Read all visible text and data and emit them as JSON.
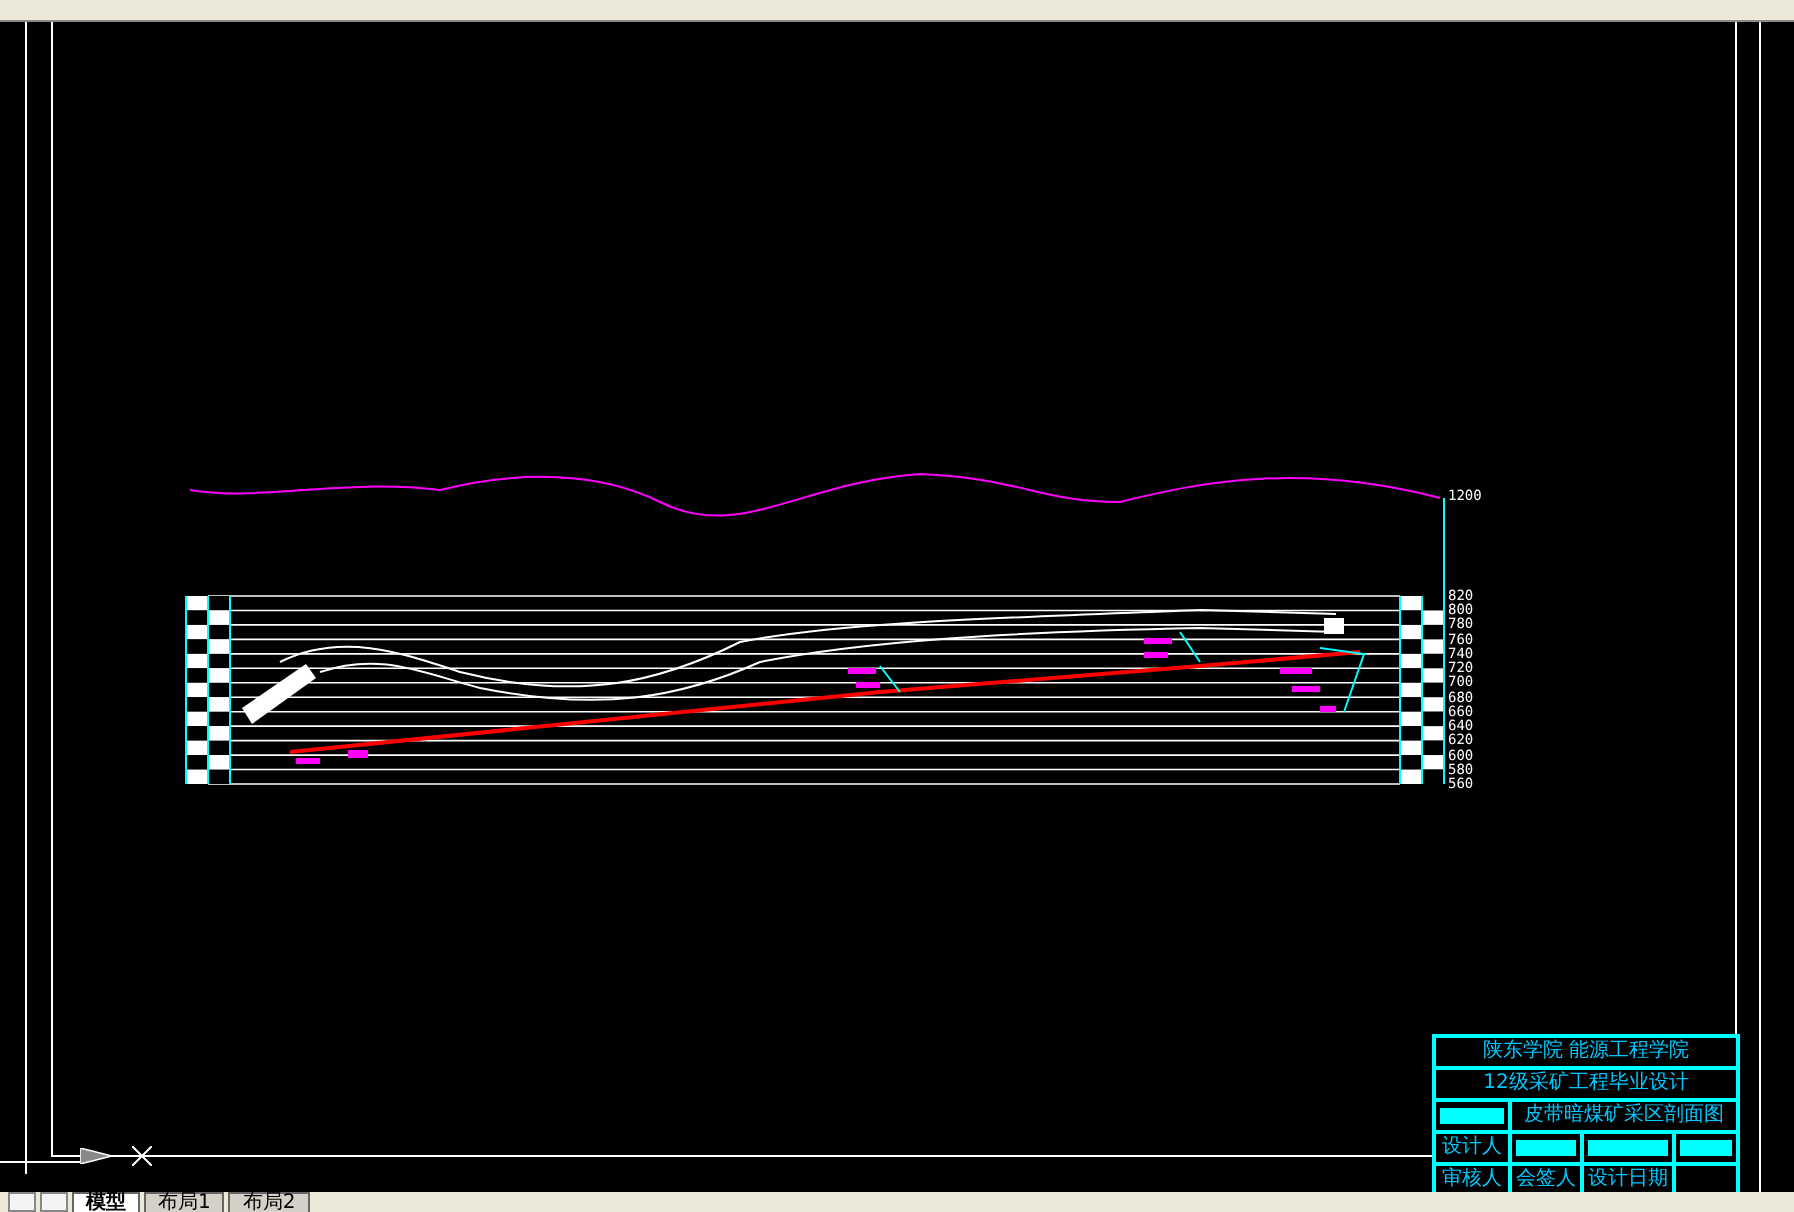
{
  "profile": {
    "top_label": "1200",
    "elevations": [
      "820",
      "800",
      "780",
      "760",
      "740",
      "720",
      "700",
      "680",
      "660",
      "640",
      "620",
      "600",
      "580",
      "560"
    ]
  },
  "title_block": {
    "school": "陕东学院 能源工程学院",
    "project": "12级采矿工程毕业设计",
    "drawing_title": "皮带暗煤矿采区剖面图",
    "row_1": [
      "设计人"
    ],
    "row_2": [
      "审核人",
      "会签人",
      "设计日期"
    ]
  },
  "tabs": [
    {
      "label": "模型",
      "selected": true
    },
    {
      "label": "布局1",
      "selected": false
    },
    {
      "label": "布局2",
      "selected": false
    }
  ]
}
